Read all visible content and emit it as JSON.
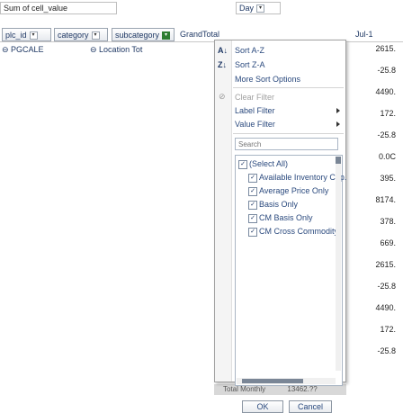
{
  "top": {
    "value_field": "Sum of cell_value",
    "column_field": "Day"
  },
  "header_buttons": [
    {
      "label": "plc_id"
    },
    {
      "label": "category"
    },
    {
      "label": "subcategory"
    }
  ],
  "grand_total": "GrandTotal",
  "date_col": "Jul-1",
  "row_labels": {
    "plc": "PGCALE",
    "location": "Location Tot"
  },
  "values": [
    "2615.",
    "-25.8",
    "4490.",
    "172.",
    "-25.8",
    "0.0C",
    "395.",
    "8174.",
    "378.",
    "669.",
    "2615.",
    "-25.8",
    "4490.",
    "172.",
    "-25.8"
  ],
  "total_row": {
    "label": "Total Monthly",
    "value": "13462.??"
  },
  "menu": {
    "sort_az": "Sort A-Z",
    "sort_za": "Sort Z-A",
    "more_sort": "More Sort Options",
    "clear_filter": "Clear Filter",
    "label_filter": "Label Filter",
    "value_filter": "Value Filter",
    "search_placeholder": "Search",
    "items": [
      {
        "label": "(Select All)",
        "checked": true
      },
      {
        "label": "Available Inventory Cap.",
        "checked": true
      },
      {
        "label": "Average Price Only",
        "checked": true
      },
      {
        "label": "Basis Only",
        "checked": true
      },
      {
        "label": "CM Basis Only",
        "checked": true
      },
      {
        "label": "CM Cross Commodity",
        "checked": true
      }
    ],
    "ok": "OK",
    "cancel": "Cancel"
  }
}
